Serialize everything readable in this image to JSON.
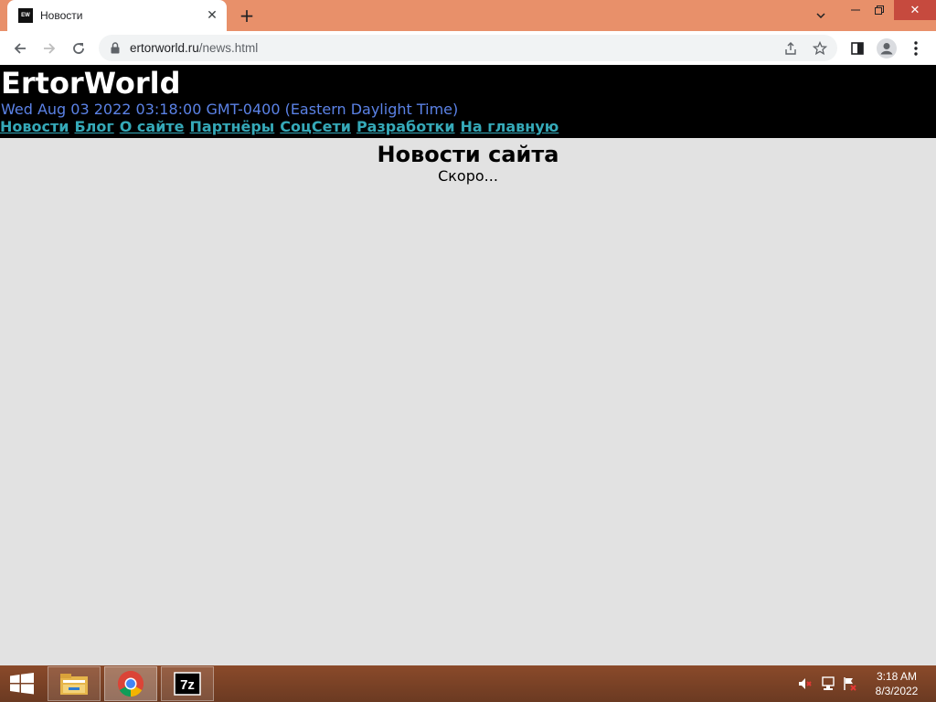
{
  "browser": {
    "tab": {
      "favicon_text": "EW",
      "title": "Новости"
    },
    "url": {
      "host": "ertorworld.ru",
      "path": "/news.html"
    }
  },
  "site": {
    "title": "ErtorWorld",
    "date": "Wed Aug 03 2022 03:18:00 GMT-0400 (Eastern Daylight Time)",
    "nav": [
      {
        "label": "Новости"
      },
      {
        "label": "Блог"
      },
      {
        "label": "О сайте"
      },
      {
        "label": "Партнёры"
      },
      {
        "label": "СоцСети"
      },
      {
        "label": "Разработки"
      },
      {
        "label": "На главную"
      }
    ],
    "heading": "Новости сайта",
    "text": "Скоро..."
  },
  "taskbar": {
    "apps": [
      {
        "icon": "file-explorer-icon"
      },
      {
        "icon": "chrome-icon"
      },
      {
        "icon": "7zip-icon",
        "label": "7z"
      }
    ],
    "clock": {
      "time": "3:18 AM",
      "date": "8/3/2022"
    }
  },
  "colors": {
    "titlebar": "#e8906a",
    "site_header_bg": "#000000",
    "site_date": "#5b82e6",
    "site_nav_link": "#35a9b8",
    "page_bg": "#e2e2e2"
  }
}
